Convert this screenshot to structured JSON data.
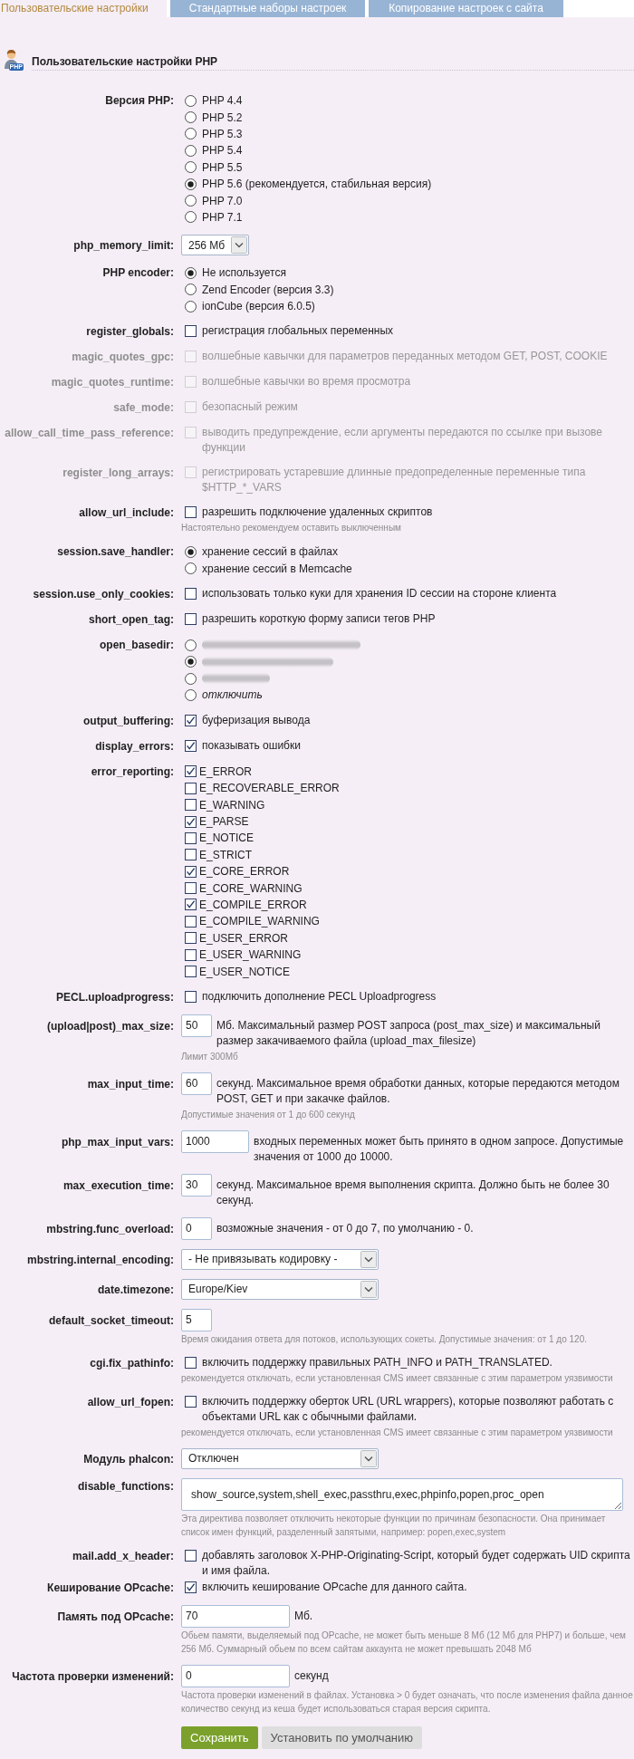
{
  "tabs": [
    {
      "label": "Пользовательские настройки",
      "selected": true
    },
    {
      "label": "Стандартные наборы настроек",
      "selected": false
    },
    {
      "label": "Копирование настроек с сайта",
      "selected": false
    }
  ],
  "section": {
    "title": "Пользовательские настройки PHP",
    "icon_badge": "PHP"
  },
  "settings": [
    {
      "kind": "radio",
      "label": "Версия PHP:",
      "options": [
        {
          "label": "PHP 4.4",
          "selected": false
        },
        {
          "label": "PHP 5.2",
          "selected": false
        },
        {
          "label": "PHP 5.3",
          "selected": false
        },
        {
          "label": "PHP 5.4",
          "selected": false
        },
        {
          "label": "PHP 5.5",
          "selected": false
        },
        {
          "label": "PHP 5.6 (рекомендуется, стабильная версия)",
          "selected": true
        },
        {
          "label": "PHP 7.0",
          "selected": false
        },
        {
          "label": "PHP 7.1",
          "selected": false
        }
      ]
    },
    {
      "kind": "select",
      "label": "php_memory_limit:",
      "value": "256 Мб"
    },
    {
      "kind": "radio",
      "label": "PHP encoder:",
      "options": [
        {
          "label": "Не используется",
          "selected": true
        },
        {
          "label": "Zend Encoder (версия 3.3)",
          "selected": false
        },
        {
          "label": "ionCube (версия 6.0.5)",
          "selected": false
        }
      ]
    },
    {
      "kind": "checkbox",
      "label": "register_globals:",
      "text": "регистрация глобальных переменных",
      "checked": false,
      "disabled": false
    },
    {
      "kind": "checkbox",
      "label": "magic_quotes_gpc:",
      "text": "волшебные кавычки для параметров переданных методом GET, POST, COOKIE",
      "checked": false,
      "disabled": true
    },
    {
      "kind": "checkbox",
      "label": "magic_quotes_runtime:",
      "text": "волшебные кавычки во время просмотра",
      "checked": false,
      "disabled": true
    },
    {
      "kind": "checkbox",
      "label": "safe_mode:",
      "text": "безопасный режим",
      "checked": false,
      "disabled": true
    },
    {
      "kind": "checkbox",
      "label": "allow_call_time_pass_reference:",
      "text": "выводить предупреждение, если аргументы передаются по ссылке при вызове функции",
      "checked": false,
      "disabled": true
    },
    {
      "kind": "checkbox",
      "label": "register_long_arrays:",
      "text": "регистрировать устаревшие длинные предопределенные переменные типа $HTTP_*_VARS",
      "checked": false,
      "disabled": true
    },
    {
      "kind": "checkbox",
      "label": "allow_url_include:",
      "text": "разрешить подключение удаленных скриптов",
      "checked": false,
      "disabled": false,
      "hint": "Настоятельно рекомендуем оставить выключенным"
    },
    {
      "kind": "radio",
      "label": "session.save_handler:",
      "options": [
        {
          "label": "хранение сессий в файлах",
          "selected": true
        },
        {
          "label": "хранение сессий в Memcache",
          "selected": false
        }
      ]
    },
    {
      "kind": "checkbox",
      "label": "session.use_only_cookies:",
      "text": "использовать только куки для хранения ID сессии на стороне клиента",
      "checked": false,
      "disabled": false
    },
    {
      "kind": "checkbox",
      "label": "short_open_tag:",
      "text": "разрешить короткую форму записи тегов PHP",
      "checked": false,
      "disabled": false
    },
    {
      "kind": "radio",
      "label": "open_basedir:",
      "options": [
        {
          "kind": "blurred",
          "selected": false
        },
        {
          "kind": "blurred",
          "selected": true
        },
        {
          "kind": "blurred",
          "selected": false
        },
        {
          "kind": "italic",
          "label": "отключить",
          "selected": false
        }
      ]
    },
    {
      "kind": "checkbox",
      "label": "output_buffering:",
      "text": "буферизация вывода",
      "checked": true,
      "disabled": false
    },
    {
      "kind": "checkbox",
      "label": "display_errors:",
      "text": "показывать ошибки",
      "checked": true,
      "disabled": false
    },
    {
      "kind": "checklist",
      "label": "error_reporting:",
      "items": [
        {
          "label": "E_ERROR",
          "checked": true
        },
        {
          "label": "E_RECOVERABLE_ERROR",
          "checked": false
        },
        {
          "label": "E_WARNING",
          "checked": false
        },
        {
          "label": "E_PARSE",
          "checked": true
        },
        {
          "label": "E_NOTICE",
          "checked": false
        },
        {
          "label": "E_STRICT",
          "checked": false
        },
        {
          "label": "E_CORE_ERROR",
          "checked": true
        },
        {
          "label": "E_CORE_WARNING",
          "checked": false
        },
        {
          "label": "E_COMPILE_ERROR",
          "checked": true
        },
        {
          "label": "E_COMPILE_WARNING",
          "checked": false
        },
        {
          "label": "E_USER_ERROR",
          "checked": false
        },
        {
          "label": "E_USER_WARNING",
          "checked": false
        },
        {
          "label": "E_USER_NOTICE",
          "checked": false
        }
      ]
    },
    {
      "kind": "checkbox",
      "label": "PECL.uploadprogress:",
      "text": "подключить дополнение PECL Uploadprogress",
      "checked": false,
      "disabled": false
    },
    {
      "kind": "input",
      "label": "(upload|post)_max_size:",
      "value": "50",
      "text": "Мб. Максимальный размер POST запроса (post_max_size) и максимальный размер закачиваемого файла (upload_max_filesize)",
      "hint": "Лимит 300Мб"
    },
    {
      "kind": "input",
      "label": "max_input_time:",
      "value": "60",
      "text": "секунд. Максимальное время обработки данных, которые передаются методом POST, GET и при закачке файлов.",
      "hint": "Допустимые значения от 1 до 600 секунд"
    },
    {
      "kind": "input",
      "label": "php_max_input_vars:",
      "value": "1000",
      "text": "входных переменных может быть принято в одном запросе. Допустимые значения от 1000 до 10000."
    },
    {
      "kind": "input",
      "label": "max_execution_time:",
      "value": "30",
      "text": "секунд. Максимальное время выполнения скрипта. Должно быть не более 30 секунд."
    },
    {
      "kind": "input",
      "label": "mbstring.func_overload:",
      "value": "0",
      "text": "возможные значения - от 0 до 7, по умолчанию - 0."
    },
    {
      "kind": "select",
      "label": "mbstring.internal_encoding:",
      "value": "- Не привязывать кодировку -"
    },
    {
      "kind": "select",
      "label": "date.timezone:",
      "value": "Europe/Kiev"
    },
    {
      "kind": "input",
      "label": "default_socket_timeout:",
      "value": "5",
      "hint": "Время ожидания ответа для потоков, использующих сокеты. Допустимые значения: от 1 до 120."
    },
    {
      "kind": "checkbox",
      "label": "cgi.fix_pathinfo:",
      "text": "включить поддержку правильных PATH_INFO и PATH_TRANSLATED.",
      "checked": false,
      "disabled": false,
      "hint": "рекомендуется отключать, если установленная CMS имеет связанные с этим параметром уязвимости"
    },
    {
      "kind": "checkbox",
      "label": "allow_url_fopen:",
      "text": "включить поддержку оберток URL (URL wrappers), которые позволяют работать с объектами URL как с обычными файлами.",
      "checked": false,
      "disabled": false,
      "hint": "рекомендуется отключать, если установленная CMS имеет связанные с этим параметром уязвимости"
    },
    {
      "kind": "select",
      "label": "Модуль phalcon:",
      "value": "Отключен"
    },
    {
      "kind": "textarea",
      "label": "disable_functions:",
      "value": "show_source,system,shell_exec,passthru,exec,phpinfo,popen,proc_open",
      "hint": "Эта директива позволяет отключить некоторые функции по причинам безопасности. Она принимает список имен функций, разделенный запятыми, например: popen,exec,system"
    },
    {
      "kind": "checkbox",
      "label": "mail.add_x_header:",
      "text": "добавлять заголовок X-PHP-Originating-Script, который будет содержать UID скрипта и имя файла.",
      "checked": false,
      "disabled": false
    },
    {
      "kind": "checkbox",
      "label": "Кеширование OPcache:",
      "text": "включить кеширование OPcache для данного сайта.",
      "checked": true,
      "disabled": false
    },
    {
      "kind": "input",
      "label": "Память под OPcache:",
      "value": "70",
      "text": "Мб.",
      "hint": "Обьем памяти, выделяемый под OPcache, не может быть меньше 8 Мб (12 Мб для PHP7) и больше, чем 256 Мб. Суммарный обьем по всем сайтам аккаунта не может превышать 2048 Мб"
    },
    {
      "kind": "input",
      "label": "Частота проверки изменений:",
      "value": "0",
      "text": "секунд",
      "hint": "Частота проверки изменений в файлах. Установка > 0 будет означать, что после изменения файла данное количество секунд из кеша будет использоваться старая версия скрипта."
    }
  ],
  "buttons": [
    {
      "label": "Сохранить",
      "kind": "primary"
    },
    {
      "label": "Установить по умолчанию",
      "kind": "secondary"
    }
  ]
}
